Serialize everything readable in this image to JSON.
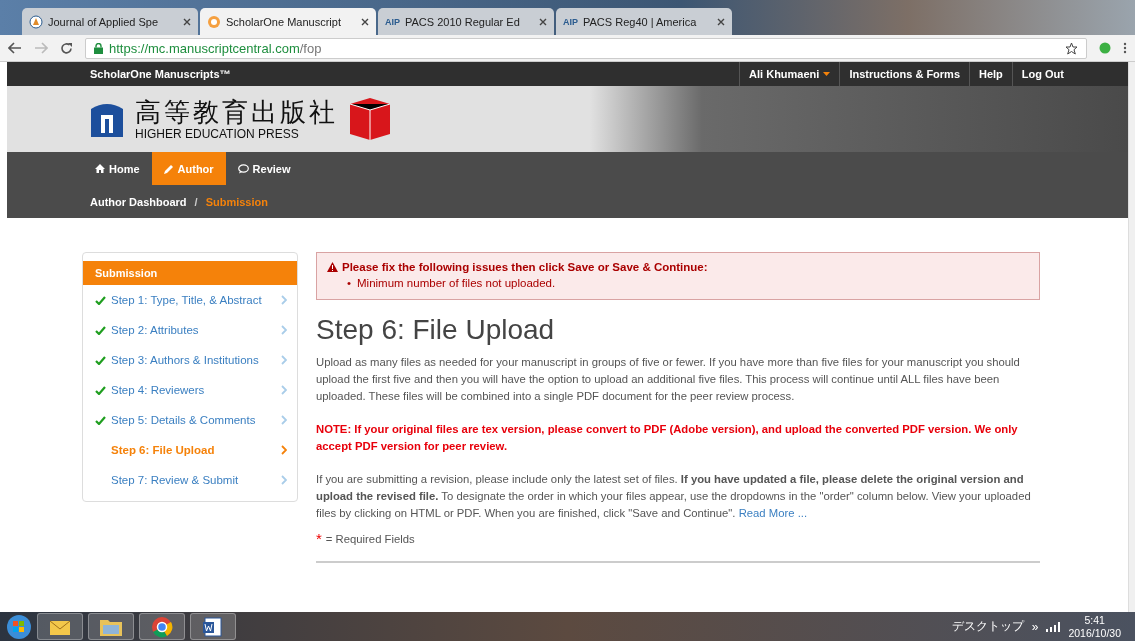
{
  "browser": {
    "tabs": [
      {
        "title": "Journal of Applied Spe",
        "selected": false
      },
      {
        "title": "ScholarOne Manuscript",
        "selected": true
      },
      {
        "title": "PACS 2010 Regular Ed",
        "favicon": "AIP",
        "selected": false
      },
      {
        "title": "PACS Reg40 | America",
        "favicon": "AIP",
        "selected": false
      }
    ],
    "url_host": "https://mc.manuscriptcentral.com",
    "url_path": "/fop"
  },
  "site": {
    "brand": "ScholarOne Manuscripts™",
    "user": "Ali Khumaeni",
    "links": [
      "Instructions & Forms",
      "Help",
      "Log Out"
    ],
    "logo_cn": "高等教育出版社",
    "logo_en": "HIGHER EDUCATION PRESS",
    "nav": [
      {
        "label": "Home",
        "selected": false
      },
      {
        "label": "Author",
        "selected": true
      },
      {
        "label": "Review",
        "selected": false
      }
    ],
    "breadcrumb": [
      "Author Dashboard",
      "/",
      "Submission"
    ]
  },
  "sidebar": {
    "title": "Submission",
    "items": [
      {
        "label": "Step 1: Type, Title, & Abstract",
        "completed": true,
        "selected": false
      },
      {
        "label": "Step 2: Attributes",
        "completed": true,
        "selected": false
      },
      {
        "label": "Step 3: Authors & Institutions",
        "completed": true,
        "selected": false
      },
      {
        "label": "Step 4: Reviewers",
        "completed": true,
        "selected": false
      },
      {
        "label": "Step 5: Details & Comments",
        "completed": true,
        "selected": false
      },
      {
        "label": "Step 6: File Upload",
        "completed": false,
        "selected": true
      },
      {
        "label": "Step 7: Review & Submit",
        "completed": false,
        "selected": false
      }
    ]
  },
  "alert": {
    "title": "Please fix the following issues then click Save or Save & Continue:",
    "bullet": "•",
    "items": [
      "Minimum number of files not uploaded."
    ]
  },
  "heading": "Step 6: File Upload",
  "intro": "Upload as many files as needed for your manuscript in groups of five or fewer. If you have more than five files for your manuscript you should upload the first five and then you will have the option to upload an additional five files. This process will continue until ALL files have been uploaded. These files will be combined into a single PDF document for the peer review process.",
  "note": "NOTE: If your original files are tex version, please convert to PDF (Adobe version), and upload the converted PDF version. We only accept PDF version for peer review.",
  "revision": "If you are submitting a revision, please include only the latest set of files. **If you have updated a file, please delete the original version and upload the revised file.** To designate the order in which your files appear, use the dropdowns in the \"order\" column below. View your uploaded files by clicking on HTML or PDF. When you are finished, click \"Save and Continue\".",
  "read_more": "Read More ...",
  "required": {
    "mark": "*",
    "text": "= Required Fields"
  },
  "taskbar": {
    "desktop": "デスクトップ",
    "chevron": "»",
    "time": "5:41",
    "date": "2016/10/30"
  }
}
